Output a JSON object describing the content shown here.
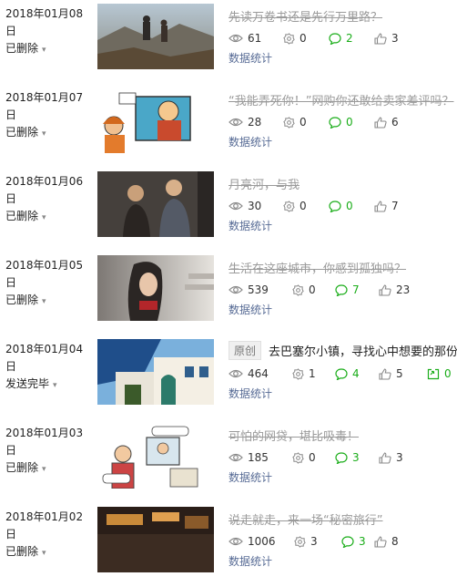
{
  "articles": [
    {
      "date": "2018年01月08日",
      "status": "已删除",
      "title": "先读万卷书还是先行万里路？",
      "stats": {
        "views": "61",
        "likes": "0",
        "comments": "2",
        "shares": "3"
      },
      "stats_link": "数据统计"
    },
    {
      "date": "2018年01月07日",
      "status": "已删除",
      "title": "“我能弄死你！”网购你还敢给卖家差评吗？",
      "stats": {
        "views": "28",
        "likes": "0",
        "comments": "0",
        "shares": "6"
      },
      "stats_link": "数据统计"
    },
    {
      "date": "2018年01月06日",
      "status": "已删除",
      "title": "月亮河，与我",
      "stats": {
        "views": "30",
        "likes": "0",
        "comments": "0",
        "shares": "7"
      },
      "stats_link": "数据统计"
    },
    {
      "date": "2018年01月05日",
      "status": "已删除",
      "title": "生活在这座城市，你感到孤独吗？",
      "stats": {
        "views": "539",
        "likes": "0",
        "comments": "7",
        "shares": "23"
      },
      "stats_link": "数据统计"
    },
    {
      "date": "2018年01月04日",
      "status": "发送完毕",
      "badge": "原创",
      "title": "去巴塞尔小镇，寻找心中想要的那份",
      "stats": {
        "views": "464",
        "likes": "1",
        "comments": "4",
        "shares": "5",
        "reprints": "0"
      },
      "stats_link": "数据统计"
    },
    {
      "date": "2018年01月03日",
      "status": "已删除",
      "title": "可怕的网贷，堪比吸毒！",
      "stats": {
        "views": "185",
        "likes": "0",
        "comments": "3",
        "shares": "3"
      },
      "stats_link": "数据统计"
    },
    {
      "date": "2018年01月02日",
      "status": "已删除",
      "title": "说走就走，来一场“秘密旅行”",
      "stats": {
        "views": "1006",
        "likes": "3",
        "comments": "3",
        "shares": "8"
      },
      "stats_link": "数据统计"
    }
  ]
}
